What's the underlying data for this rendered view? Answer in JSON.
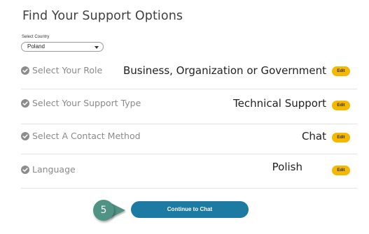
{
  "page": {
    "title": "Find Your Support Options"
  },
  "country": {
    "label": "Select Country",
    "selected": "Poland"
  },
  "rows": [
    {
      "label": "Select Your Role",
      "value": "Business, Organization or Government",
      "edit": "Edit"
    },
    {
      "label": "Select Your Support Type",
      "value": "Technical Support",
      "edit": "Edit"
    },
    {
      "label": "Select A Contact Method",
      "value": "Chat",
      "edit": "Edit"
    },
    {
      "label": "Language",
      "value": "Polish",
      "edit": "Edit"
    }
  ],
  "cta": {
    "step_number": "5",
    "button_label": "Continue to Chat"
  },
  "colors": {
    "accent_yellow": "#f5b800",
    "button_blue": "#1c7aa3",
    "step_green": "#4f9385",
    "check_gray": "#8c8c8c"
  }
}
